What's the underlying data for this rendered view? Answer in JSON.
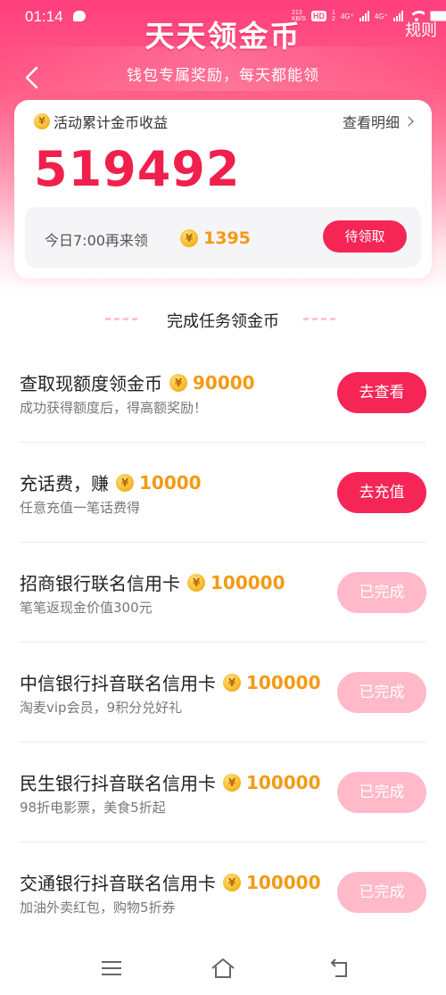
{
  "status_bar": {
    "time": "01:14",
    "net1_top": "213",
    "net1_bottom": "KB/S",
    "hd": "HD",
    "sim1": "1",
    "sim2": "2",
    "net2": "4G⁺",
    "net3": "4G⁺",
    "battery": "94"
  },
  "header": {
    "title": "天天领金币",
    "rules": "规则",
    "subtitle": "钱包专属奖励，每天都能领"
  },
  "card": {
    "label": "活动累计金币收益",
    "detail_link": "查看明细",
    "total": "519492",
    "claim_text": "今日7:00再来领",
    "claim_amount": "1395",
    "claim_button": "待领取"
  },
  "coin_symbol": "¥",
  "section": {
    "title": "完成任务领金币"
  },
  "tasks": [
    {
      "title": "查取现额度领金币",
      "reward": "90000",
      "subtitle": "成功获得额度后，得高额奖励！",
      "button": "去查看",
      "done": false
    },
    {
      "title": "充话费，赚",
      "reward": "10000",
      "subtitle": "任意充值一笔话费得",
      "button": "去充值",
      "done": false
    },
    {
      "title": "招商银行联名信用卡",
      "reward": "100000",
      "subtitle": "笔笔返现金价值300元",
      "button": "已完成",
      "done": true
    },
    {
      "title": "中信银行抖音联名信用卡",
      "reward": "100000",
      "subtitle": "淘麦vip会员，9积分兑好礼",
      "button": "已完成",
      "done": true
    },
    {
      "title": "民生银行抖音联名信用卡",
      "reward": "100000",
      "subtitle": "98折电影票，美食5折起",
      "button": "已完成",
      "done": true
    },
    {
      "title": "交通银行抖音联名信用卡",
      "reward": "100000",
      "subtitle": "加油外卖红包，购物5折券",
      "button": "已完成",
      "done": true
    }
  ],
  "navbar": {
    "icons": [
      "menu-icon",
      "home-icon",
      "back-icon"
    ]
  },
  "colors": {
    "accent": "#f52556",
    "accent_light": "#ffb9c9",
    "total_red": "#f0204d",
    "coin_orange": "#f39a14"
  }
}
